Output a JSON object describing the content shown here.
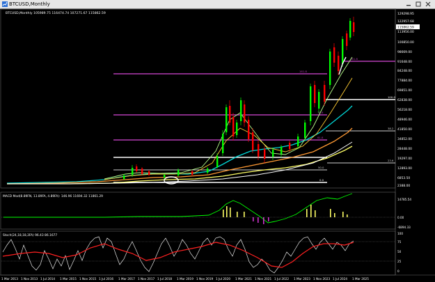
{
  "window": {
    "title": "BTCUSD,Monthly"
  },
  "main_panel": {
    "header": "BTCUSD,Monthly 105989.75 116474.74 107271.67 115862.59",
    "price_labels": [
      "129298.95",
      "122957.68",
      "115862.59",
      "113956.00",
      "100850.00",
      "98669.00",
      "91648.00",
      "84248.00",
      "77884.00",
      "69851.00",
      "62838.00",
      "56218.00",
      "48946.00",
      "41850.00",
      "34852.00",
      "28448.00",
      "19297.00",
      "12893.00",
      "6853.50",
      "2388.00"
    ],
    "price_tag": "115862.59",
    "fib_labels": [
      "161.8",
      "100.0",
      "78.6",
      "61.8",
      "50.0",
      "38.2",
      "23.6",
      "0.0"
    ],
    "colors": {
      "magenta": "#b23cb2",
      "green": "#00ff00",
      "red": "#ff0000",
      "cyan": "#00d8d8",
      "orange": "#ff9933",
      "yellow": "#ffff66",
      "white": "#ffffff"
    }
  },
  "macd_panel": {
    "header": "MACD Mod(8.89FN, 13.89FA, 4.89FA): 146.96 11694.32 11861.29",
    "scale_labels": [
      "14785.54",
      "0.00",
      "-6894.33"
    ]
  },
  "stoch_panel": {
    "header": "Stoch(24,18,18,3FA) 96.43 86.1677",
    "scale_labels": [
      "100",
      "75",
      "50",
      "25",
      "0"
    ]
  },
  "time_axis": {
    "labels": [
      "1 Mar 2013",
      "1 Nov 2013",
      "1 Jul 2014",
      "1 Mar 2015",
      "1 Nov 2015",
      "1 Jul 2016",
      "1 Mar 2017",
      "1 Nov 2017",
      "1 Jul 2018",
      "1 Mar 2019",
      "1 Nov 2019",
      "1 Jul 2020",
      "1 Mar 2021",
      "1 Nov 2021",
      "1 Jul 2022",
      "1 Mar 2023",
      "1 Nov 2023",
      "1 Jul 2024",
      "1 Mar 2025"
    ]
  }
}
